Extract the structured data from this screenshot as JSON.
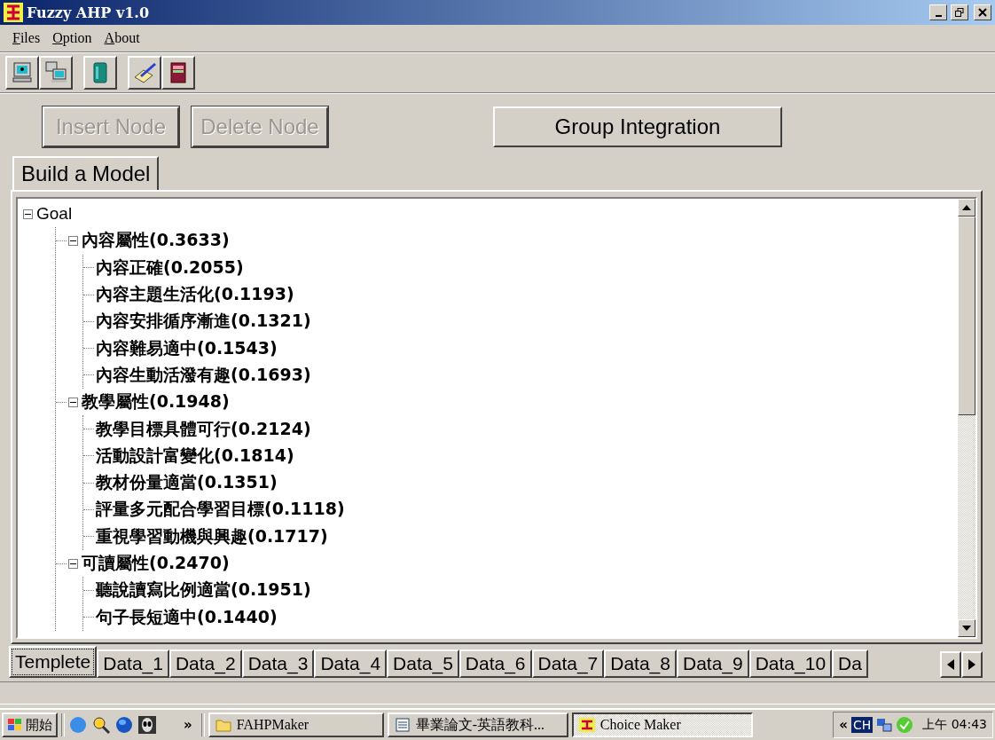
{
  "window": {
    "title": "Fuzzy AHP v1.0"
  },
  "menu": [
    {
      "label": "Files"
    },
    {
      "label": "Option"
    },
    {
      "label": "About"
    }
  ],
  "actions": [
    {
      "label": "Insert Node",
      "disabled": true
    },
    {
      "label": "Delete Node",
      "disabled": true
    },
    {
      "label": "Group Integration",
      "disabled": false
    }
  ],
  "model_tabs": [
    {
      "label": "Build a Model",
      "selected": true
    }
  ],
  "tree": [
    {
      "label": "Goal",
      "expanded": true,
      "children": [
        {
          "label": "內容屬性(0.3633)",
          "expanded": true,
          "children": [
            {
              "label": "內容正確(0.2055)"
            },
            {
              "label": "內容主題生活化(0.1193)"
            },
            {
              "label": "內容安排循序漸進(0.1321)"
            },
            {
              "label": "內容難易適中(0.1543)"
            },
            {
              "label": "內容生動活潑有趣(0.1693)"
            }
          ]
        },
        {
          "label": "教學屬性(0.1948)",
          "expanded": true,
          "children": [
            {
              "label": "教學目標具體可行(0.2124)"
            },
            {
              "label": "活動設計富變化(0.1814)"
            },
            {
              "label": "教材份量適當(0.1351)"
            },
            {
              "label": "評量多元配合學習目標(0.1118)"
            },
            {
              "label": "重視學習動機與興趣(0.1717)"
            }
          ]
        },
        {
          "label": "可讀屬性(0.2470)",
          "expanded": true,
          "children": [
            {
              "label": "聽說讀寫比例適當(0.1951)"
            },
            {
              "label": "句子長短適中(0.1440)"
            }
          ]
        }
      ]
    }
  ],
  "data_tabs": [
    {
      "label": "Templete",
      "selected": true
    },
    {
      "label": "Data_1",
      "selected": false
    },
    {
      "label": "Data_2",
      "selected": false
    },
    {
      "label": "Data_3",
      "selected": false
    },
    {
      "label": "Data_4",
      "selected": false
    },
    {
      "label": "Data_5",
      "selected": false
    },
    {
      "label": "Data_6",
      "selected": false
    },
    {
      "label": "Data_7",
      "selected": false
    },
    {
      "label": "Data_8",
      "selected": false
    },
    {
      "label": "Data_9",
      "selected": false
    },
    {
      "label": "Data_10",
      "selected": false
    },
    {
      "label": "Da",
      "selected": false
    }
  ],
  "taskbar": {
    "start": "開始",
    "more": "»",
    "tasks": [
      {
        "label": "FAHPMaker",
        "selected": false
      },
      {
        "label": "畢業論文-英語教科...",
        "selected": false
      },
      {
        "label": "Choice Maker",
        "selected": true
      }
    ],
    "tray_more": "«",
    "input_method": "CH",
    "clock": "上午 04:43"
  }
}
